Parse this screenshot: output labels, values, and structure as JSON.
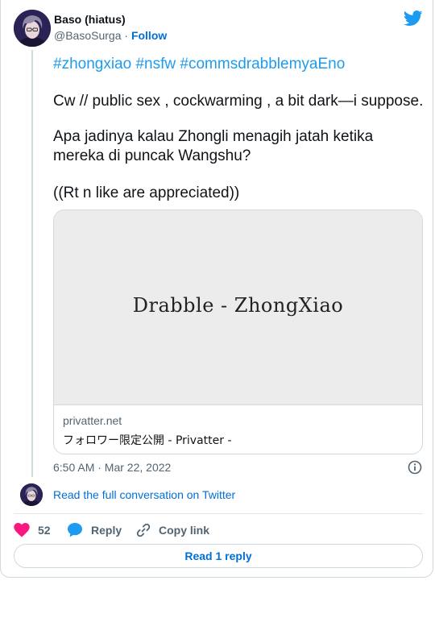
{
  "author": {
    "name": "Baso (hiatus)",
    "handle": "@BasoSurga",
    "separator": "·",
    "follow_label": "Follow"
  },
  "tweet": {
    "hashtags": [
      "#zhongxiao",
      "#nsfw",
      "#commsdrabblemyaEno"
    ],
    "line1": "Cw // public sex , cockwarming , a bit dark—i suppose.",
    "line2": "Apa jadinya kalau Zhongli menagih jatah ketika mereka di puncak Wangshu?",
    "line3": "((Rt n like are appreciated))"
  },
  "link_card": {
    "preview_title": "Drabble  -  ZhongXiao",
    "domain": "privatter.net",
    "title": "フォロワー限定公開 - Privatter -"
  },
  "meta": {
    "timestamp": "6:50 AM · Mar 22, 2022"
  },
  "conversation": {
    "read_full_label": "Read the full conversation on Twitter"
  },
  "actions": {
    "like_count": "52",
    "reply_label": "Reply",
    "copy_label": "Copy link",
    "read_reply_label": "Read 1 reply"
  },
  "colors": {
    "link": "#006fd6",
    "hashtag": "#1d9bf0",
    "like": "#f91880",
    "border": "#cfd9de",
    "muted": "#536471"
  },
  "icons": {
    "brand": "twitter-bird-icon",
    "info": "info-icon",
    "like": "heart-icon",
    "reply": "speech-bubble-icon",
    "copy": "link-icon"
  }
}
